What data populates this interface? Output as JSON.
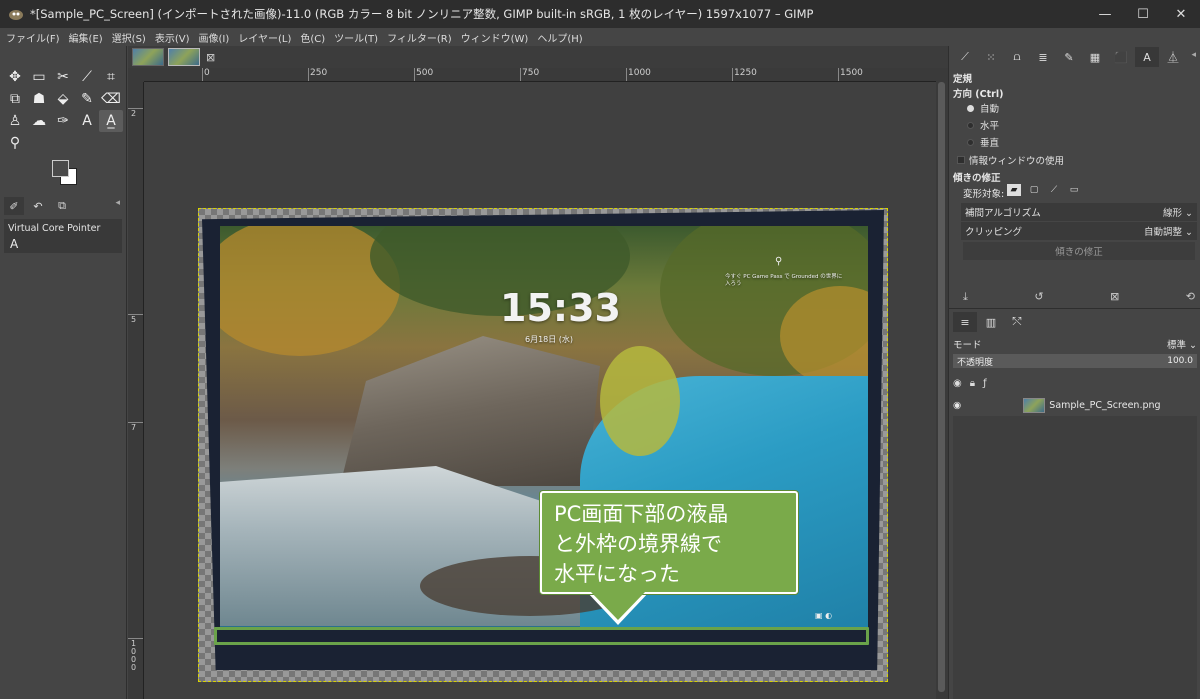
{
  "window": {
    "title": "*[Sample_PC_Screen] (インポートされた画像)-11.0 (RGB カラー 8 bit ノンリニア整数, GIMP built-in sRGB, 1 枚のレイヤー) 1597x1077 – GIMP",
    "minimize": "—",
    "maximize": "☐",
    "close": "✕"
  },
  "menubar": [
    "ファイル(F)",
    "編集(E)",
    "選択(S)",
    "表示(V)",
    "画像(I)",
    "レイヤー(L)",
    "色(C)",
    "ツール(T)",
    "フィルター(R)",
    "ウィンドウ(W)",
    "ヘルプ(H)"
  ],
  "toolbox": {
    "tools": [
      {
        "name": "move-tool-icon",
        "glyph": "✥"
      },
      {
        "name": "rect-select-icon",
        "glyph": "▭"
      },
      {
        "name": "scissors-select-icon",
        "glyph": "✂"
      },
      {
        "name": "fuzzy-select-icon",
        "glyph": "⟋"
      },
      {
        "name": "crop-icon",
        "glyph": "⌗"
      },
      {
        "name": "unified-transform-icon",
        "glyph": "⧉"
      },
      {
        "name": "warp-transform-icon",
        "glyph": "☗"
      },
      {
        "name": "bucket-fill-icon",
        "glyph": "⬙"
      },
      {
        "name": "paintbrush-icon",
        "glyph": "✎"
      },
      {
        "name": "eraser-icon",
        "glyph": "⌫"
      },
      {
        "name": "clone-icon",
        "glyph": "♙"
      },
      {
        "name": "smudge-icon",
        "glyph": "☁"
      },
      {
        "name": "paths-icon",
        "glyph": "✑"
      },
      {
        "name": "text-icon",
        "glyph": "A"
      },
      {
        "name": "straighten-text-icon",
        "glyph": "A̲"
      },
      {
        "name": "zoom-icon",
        "glyph": "⚲"
      }
    ],
    "device_status_label": "Virtual Core Pointer",
    "device_glyph": "A"
  },
  "image_tabs": {
    "close": "⊠"
  },
  "hruler": [
    "0",
    "250",
    "500",
    "750",
    "1000",
    "1250",
    "1500"
  ],
  "vruler": [
    "2",
    "5",
    "7",
    "1000"
  ],
  "canvas": {
    "clock_time": "15:33",
    "clock_date": "6月18日 (水)",
    "promo_text": "今すぐ PC Game Pass で Grounded の世界に入ろう",
    "callout_lines": [
      "PC画面下部の液晶",
      "と外枠の境界線で",
      "水平になった"
    ],
    "highlight_color": "#6aa34a",
    "callout_color": "#7aaa4a"
  },
  "tool_options": {
    "section_title": "定規",
    "orientation_label": "方向 (Ctrl)",
    "orientation_options": [
      {
        "label": "自動",
        "selected": true
      },
      {
        "label": "水平",
        "selected": false
      },
      {
        "label": "垂直",
        "selected": false
      }
    ],
    "info_window_checkbox": "情報ウィンドウの使用",
    "straighten_title": "傾きの修正",
    "transform_target_label": "変形対象:",
    "interpolation_label": "補間アルゴリズム",
    "interpolation_value": "線形 ⌄",
    "clipping_label": "クリッピング",
    "clipping_value": "自動調整 ⌄",
    "straighten_button": "傾きの修正"
  },
  "layers": {
    "mode_label": "モード",
    "mode_value": "標準 ⌄",
    "opacity_label": "不透明度",
    "opacity_value": "100.0",
    "layer_name": "Sample_PC_Screen.png"
  }
}
